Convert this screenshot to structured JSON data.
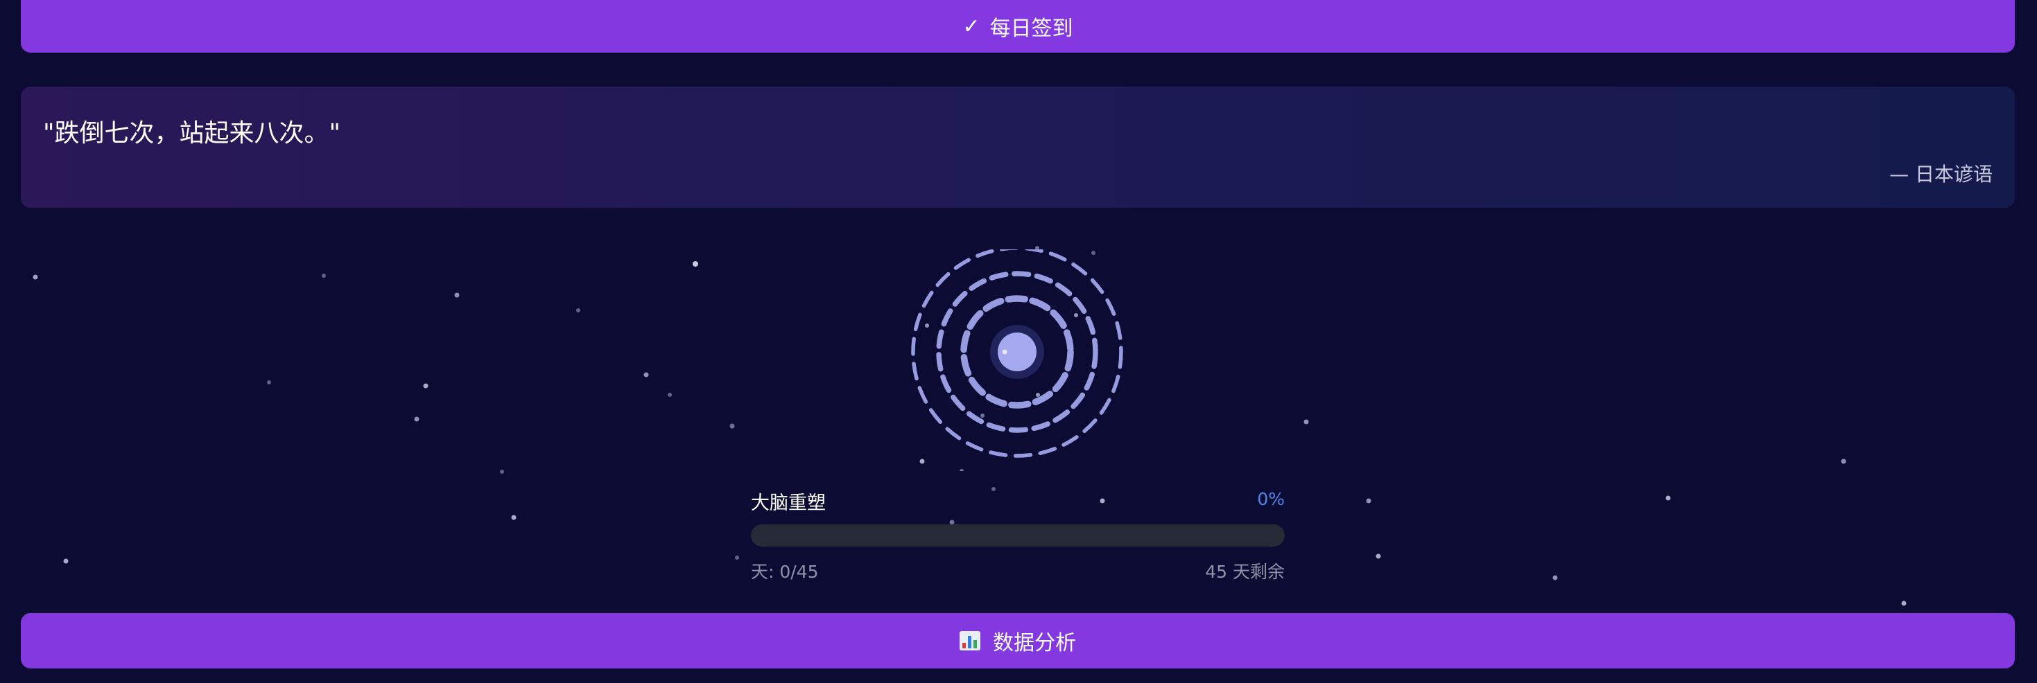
{
  "checkin_button": {
    "icon": "checkmark-icon",
    "icon_glyph": "✓",
    "label": "每日签到"
  },
  "quote": {
    "text": "\"跌倒七次，站起来八次。\"",
    "author": "— 日本谚语"
  },
  "progress": {
    "label": "大脑重塑",
    "percent_text": "0%",
    "percent": 0,
    "days_text": "天: 0/45",
    "remaining_text": "45 天剩余"
  },
  "analytics_button": {
    "icon": "bar-chart-icon",
    "label": "数据分析"
  },
  "colors": {
    "background": "#0b0b33",
    "accent": "#8338e0",
    "progress_percent": "#4f86e8",
    "orb": "#a4a9f0"
  }
}
